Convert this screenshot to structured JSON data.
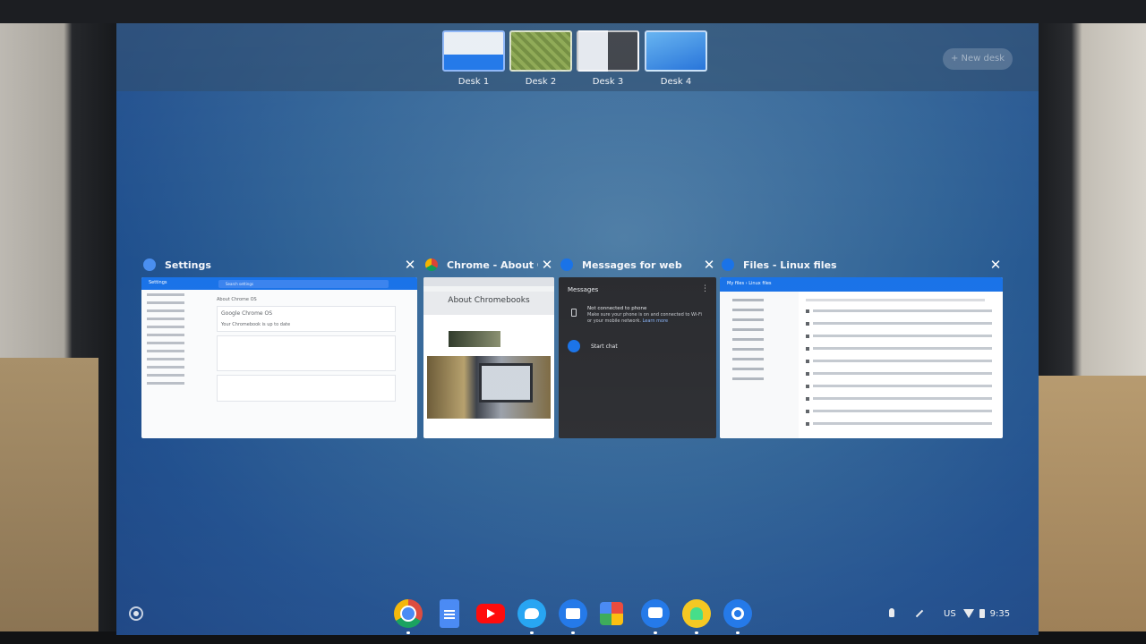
{
  "desks": [
    {
      "label": "Desk 1"
    },
    {
      "label": "Desk 2"
    },
    {
      "label": "Desk 3"
    },
    {
      "label": "Desk 4"
    }
  ],
  "new_desk_label": "+ New desk",
  "windows": [
    {
      "title": "Settings",
      "icon": "settings-icon",
      "preview": {
        "search_placeholder": "Search settings",
        "header": "Settings",
        "section": "About Chrome OS",
        "product": "Google Chrome OS",
        "status": "Your Chromebook is up to date"
      }
    },
    {
      "title": "Chrome - About C...",
      "icon": "chrome-icon",
      "preview": {
        "heading": "About Chromebooks"
      }
    },
    {
      "title": "Messages for web",
      "icon": "messages-icon",
      "preview": {
        "app_title": "Messages",
        "notice_title": "Not connected to phone",
        "notice_body": "Make sure your phone is on and connected to Wi-Fi or your mobile network.",
        "learn_more": "Learn more",
        "start_chat": "Start chat"
      }
    },
    {
      "title": "Files - Linux files",
      "icon": "files-icon",
      "preview": {
        "breadcrumb": "My files › Linux files"
      }
    }
  ],
  "shelf": {
    "apps": [
      "chrome-icon",
      "docs-icon",
      "youtube-icon",
      "twitter-icon",
      "files-icon",
      "photos-icon",
      "messages-icon",
      "android-studio-icon",
      "settings-icon"
    ]
  },
  "tray": {
    "lang": "US",
    "time": "9:35"
  },
  "colors": {
    "accent": "#1a73e8",
    "wallpaper": "#2f6296"
  }
}
